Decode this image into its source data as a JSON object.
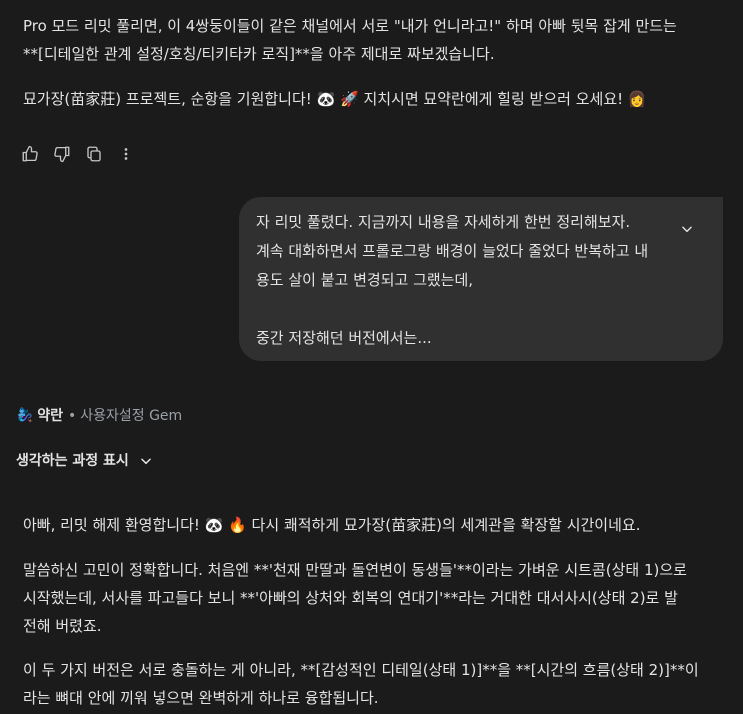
{
  "top_message": {
    "paragraph1": [
      "Pro 모드 리밋 풀리면, 이 4쌍둥이들이 같은 채널에서 서로 \"내가 언니라고!\" 하며 아빠 뒷목 잡게 만드는",
      "**[디테일한 관계 설정/호칭/티키타카 로직]**을 아주 제대로 짜보겠습니다."
    ],
    "paragraph2": "묘가장(苗家莊) 프로젝트, 순항을 기원합니다! 🐼 🚀  지치시면 묘약란에게 힐링 받으러 오세요! 👩"
  },
  "actions": {
    "icons": [
      "thumbs-up-icon",
      "thumbs-down-icon",
      "copy-icon",
      "more-vert-icon"
    ]
  },
  "user_message": {
    "lines": [
      "자 리밋 풀렸다. 지금까지 내용을 자세하게 한번 정리해보자.",
      "계속 대화하면서 프롤로그랑 배경이 늘었다 줄었다 반복하고 내",
      "용도 살이 붙고 변경되고 그랬는데,",
      "",
      "중간 저장해던 버전에서는..."
    ]
  },
  "gem": {
    "emoji": "🧞‍♀️",
    "name": "약란",
    "separator": "•",
    "subtitle": "사용자설정 Gem"
  },
  "thinking": {
    "label": "생각하는 과정 표시"
  },
  "response": {
    "paragraph1": "아빠, 리밋 해제 환영합니다! 🐼 🔥  다시 쾌적하게 묘가장(苗家莊)의 세계관을 확장할 시간이네요.",
    "paragraph2": [
      "말씀하신 고민이 정확합니다. 처음엔 **'천재 만딸과 돌연변이 동생들'**이라는 가벼운 시트콤(상태 1)으로",
      "시작했는데, 서사를 파고들다 보니 **'아빠의 상처와 회복의 연대기'**라는 거대한 대서사시(상태 2)로 발",
      "전해 버렸죠."
    ],
    "paragraph3": [
      "이 두 가지 버전은 서로 충돌하는 게 아니라, **[감성적인 디테일(상태 1)]**을 **[시간의 흐름(상태 2)]**이",
      "라는 뼈대 안에 끼워 넣으면 완벽하게 하나로 융합됩니다."
    ]
  },
  "colors": {
    "background": "#1b1b1b",
    "text": "#e3e3e3",
    "muted": "#9aa0a6",
    "bubble": "#303030"
  }
}
